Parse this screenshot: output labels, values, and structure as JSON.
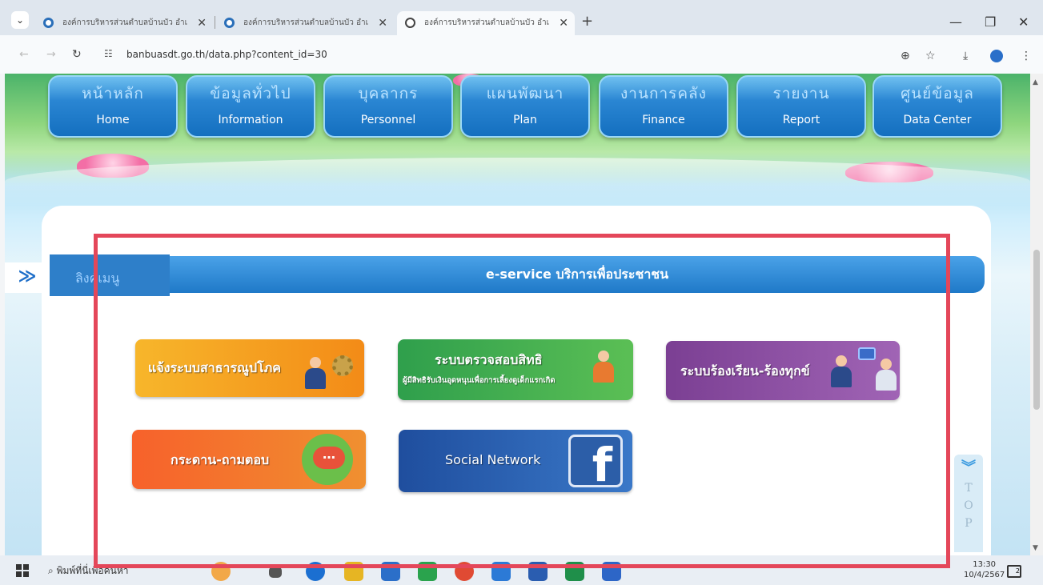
{
  "browser": {
    "tabs": [
      {
        "title": "องค์การบริหารส่วนตำบลบ้านบัว อำเ",
        "active": false
      },
      {
        "title": "องค์การบริหารส่วนตำบลบ้านบัว อำเ",
        "active": false
      },
      {
        "title": "องค์การบริหารส่วนตำบลบ้านบัว อำเ",
        "active": true
      }
    ],
    "close_glyph": "✕",
    "new_tab_glyph": "+",
    "url": "banbuasdt.go.th/data.php?content_id=30"
  },
  "menu": [
    {
      "th": "หน้าหลัก",
      "en": "Home"
    },
    {
      "th": "ข้อมูลทั่วไป",
      "en": "Information"
    },
    {
      "th": "บุคลากร",
      "en": "Personnel"
    },
    {
      "th": "แผนพัฒนา",
      "en": "Plan"
    },
    {
      "th": "งานการคลัง",
      "en": "Finance"
    },
    {
      "th": "รายงาน",
      "en": "Report"
    },
    {
      "th": "ศูนย์ข้อมูล",
      "en": "Data Center"
    }
  ],
  "sidebar": {
    "toggle_glyph": "≫",
    "label": "ลิงค์เมนู"
  },
  "section": {
    "title": "e-service บริการเพื่อประชาชน"
  },
  "services": [
    {
      "label": "แจ้งระบบสาธารณูปโภค",
      "color": "#f59e22"
    },
    {
      "label": "ระบบตรวจสอบสิทธิ",
      "sub": "ผู้มีสิทธิรับเงินอุดหนุนเพื่อการเลี้ยงดูเด็กแรกเกิด",
      "color": "#3aa64d"
    },
    {
      "label": "ระบบร้องเรียน-ร้องทุกข์",
      "color": "#8a4da3"
    },
    {
      "label": "กระดาน-ถามตอบ",
      "color": "#f4702c"
    },
    {
      "label": "Social Network",
      "color": "#2a5fb0"
    }
  ],
  "top_button": {
    "letters": [
      "T",
      "O",
      "P"
    ],
    "chevron": "︾"
  },
  "annotation_color": "#e4475a",
  "taskbar": {
    "search_text": "พิมพ์ที่นี่เพื่อค้นหา",
    "time": "13:30",
    "date": "10/4/2567",
    "notifications": "2"
  }
}
